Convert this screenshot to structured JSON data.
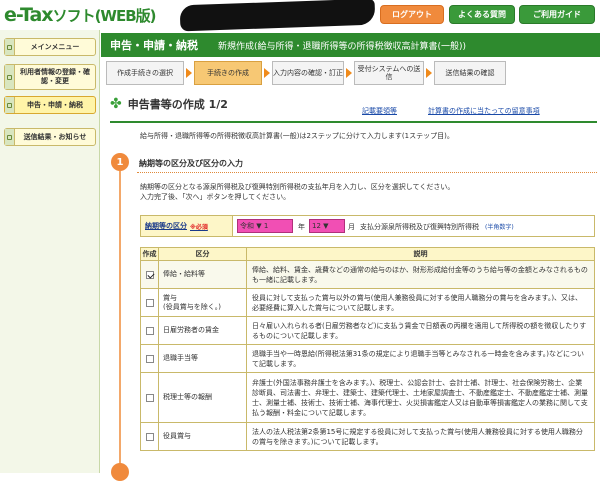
{
  "header": {
    "logo_main": "e-Tax",
    "logo_sub": "ソフト(WEB版)",
    "logout": "ログアウト",
    "faq": "よくある質問",
    "guide": "ご利用ガイド"
  },
  "sidebar": {
    "items": [
      {
        "label": "メインメニュー"
      },
      {
        "label": "利用者情報の登録・確認・変更"
      },
      {
        "label": "申告・申請・納税"
      },
      {
        "label": "送信結果・お知らせ"
      }
    ]
  },
  "title_bar": {
    "main": "申告・申請・納税",
    "sub": "新規作成(給与所得・退職所得等の所得税徴収高計算書(一般))"
  },
  "steps": [
    {
      "label": "作成手続きの選択"
    },
    {
      "label": "手続きの作成"
    },
    {
      "label": "入力内容の確認・訂正"
    },
    {
      "label": "受付システムへの送信"
    },
    {
      "label": "送信結果の確認"
    }
  ],
  "section": {
    "title": "申告書等の作成 1/2",
    "link1": "記載要領等",
    "link2": "計算書の作成に当たっての留意事項",
    "intro": "給与所得・退職所得等の所得税徴収高計算書(一般)は2ステップに分けて入力します(1ステップ目)。"
  },
  "step1": {
    "number": "1",
    "heading": "納期等の区分及び区分の入力",
    "desc1": "納期等の区分となる源泉所得税及び復興特別所得税の支払年月を入力し、区分を選択してください。",
    "desc2": "入力完了後、「次へ」ボタンを押してください。"
  },
  "period": {
    "label": "納期等の区分",
    "required": "※必須",
    "era": "令和",
    "year": "1",
    "year_unit": "年",
    "month": "12",
    "month_unit": "月",
    "text": "支払分源泉所得税及び復興特別所得税",
    "link": "(半角数字)"
  },
  "table": {
    "headers": {
      "check": "作成",
      "category": "区分",
      "description": "説明"
    },
    "rows": [
      {
        "checked": true,
        "category": "俸給・給料等",
        "description": "俸給、給料、賃金、歳費などの通常の給与のほか、財形形成給付金等のうち給与等の金額とみなされるものも一緒に記載します。"
      },
      {
        "checked": false,
        "category": "賞与\n(役員賞与を除く。)",
        "description": "役員に対して支払った賞与以外の賞与(使用人兼務役員に対する使用人職務分の賞与を含みます。)、又は、必要経費に算入した賞与について記載します。"
      },
      {
        "checked": false,
        "category": "日雇労務者の賃金",
        "description": "日々雇い入れられる者(日雇労務者など)に支払う賃金で日額表の丙欄を適用して所得税の額を徴収したりするものについて記載します。"
      },
      {
        "checked": false,
        "category": "退職手当等",
        "description": "退職手当や一時恩給(所得税法第31条の規定により退職手当等とみなされる一時金を含みます。)などについて記載します。"
      },
      {
        "checked": false,
        "category": "税理士等の報酬",
        "description": "弁護士(外国法事務弁護士を含みます。)、税理士、公認会計士、会計士補、計理士、社会保険労務士、企業診断員、司法書士、弁理士、建築士、建築代理士、土地家屋調査士、不動産鑑定士、不動産鑑定士補、測量士、測量士補、技術士、技術士補、海事代理士、火災損害鑑定人又は自動車等損害鑑定人の業務に関して支払う報酬・料金について記載します。"
      },
      {
        "checked": false,
        "category": "役員賞与",
        "description": "法人の法人税法第2条第15号に規定する役員に対して支払った賞与(使用人兼務役員に対する使用人職務分の賞与を除きます。)について記載します。"
      }
    ]
  }
}
